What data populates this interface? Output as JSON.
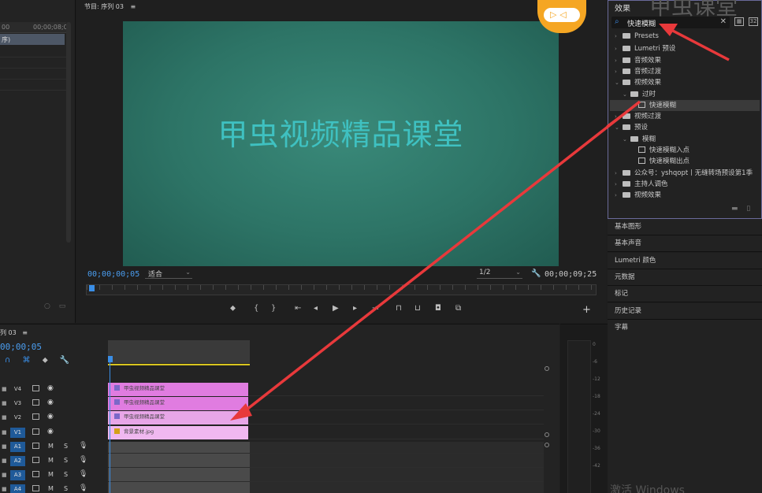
{
  "left_panel": {
    "col1": "00",
    "col2": "00;00;08;0",
    "sel_label": "序)"
  },
  "program_monitor": {
    "title": "节目: 序列 03",
    "menu_glyph": "≡",
    "video_caption": "甲虫视频精品课堂",
    "timecode_current": "00;00;00;05",
    "fit_label": "适合",
    "resolution_label": "1/2",
    "timecode_total": "00;00;09;25"
  },
  "effects_panel": {
    "title": "效果",
    "overlay_title": "甲虫课堂",
    "search_value": "快速模糊",
    "tree": [
      {
        "label": "Presets",
        "level": 0,
        "kind": "folder",
        "expanded": false
      },
      {
        "label": "Lumetri 预设",
        "level": 0,
        "kind": "folder",
        "expanded": false
      },
      {
        "label": "音频效果",
        "level": 0,
        "kind": "folder",
        "expanded": false
      },
      {
        "label": "音频过渡",
        "level": 0,
        "kind": "folder",
        "expanded": false
      },
      {
        "label": "视频效果",
        "level": 0,
        "kind": "folder",
        "expanded": true
      },
      {
        "label": "过时",
        "level": 1,
        "kind": "folder",
        "expanded": true
      },
      {
        "label": "快速模糊",
        "level": 2,
        "kind": "effect",
        "selected": true
      },
      {
        "label": "视频过渡",
        "level": 0,
        "kind": "folder",
        "expanded": false
      },
      {
        "label": "预设",
        "level": 0,
        "kind": "folder",
        "expanded": true
      },
      {
        "label": "模糊",
        "level": 1,
        "kind": "folder",
        "expanded": true
      },
      {
        "label": "快速模糊入点",
        "level": 2,
        "kind": "effect"
      },
      {
        "label": "快速模糊出点",
        "level": 2,
        "kind": "effect"
      },
      {
        "label": "公众号：yshqopt丨无缝转场预设第1季",
        "level": 0,
        "kind": "folder",
        "expanded": false
      },
      {
        "label": "主持人调色",
        "level": 0,
        "kind": "folder",
        "expanded": false
      },
      {
        "label": "视频效果",
        "level": 0,
        "kind": "folder",
        "expanded": false
      }
    ]
  },
  "side_panels": [
    "基本图形",
    "基本声音",
    "Lumetri 颜色",
    "元数据",
    "标记",
    "历史记录",
    "字幕"
  ],
  "watermark": "激活 Windows",
  "timeline": {
    "title": "列 03",
    "timecode": "00;00;05",
    "video_tracks": [
      {
        "name": "V4",
        "selected": false
      },
      {
        "name": "V3",
        "selected": false
      },
      {
        "name": "V2",
        "selected": false
      },
      {
        "name": "V1",
        "selected": true
      }
    ],
    "audio_tracks": [
      {
        "name": "A1",
        "selected": true
      },
      {
        "name": "A2",
        "selected": true
      },
      {
        "name": "A3",
        "selected": true
      },
      {
        "name": "A4",
        "selected": true
      }
    ],
    "clips": [
      {
        "track": "V4",
        "label": "甲虫视频精品课堂",
        "color": "#e07ce0"
      },
      {
        "track": "V3",
        "label": "甲虫视频精品课堂",
        "color": "#e07ce0"
      },
      {
        "track": "V2",
        "label": "甲虫视频精品课堂",
        "color": "#e8a6e8"
      },
      {
        "track": "V1",
        "label": "背景素材.jpg",
        "color": "#f0b8f0"
      }
    ],
    "m_label": "M",
    "s_label": "S"
  },
  "meters": {
    "labels": [
      "0",
      "-6",
      "-12",
      "-18",
      "-24",
      "-30",
      "-36",
      "-42"
    ]
  },
  "colors": {
    "accent": "#3a8ee6",
    "arrow": "#e8393b",
    "clip_pink": "#e07ce0",
    "video_bg": "#2e7a6b",
    "caption": "#3fc1c1"
  }
}
